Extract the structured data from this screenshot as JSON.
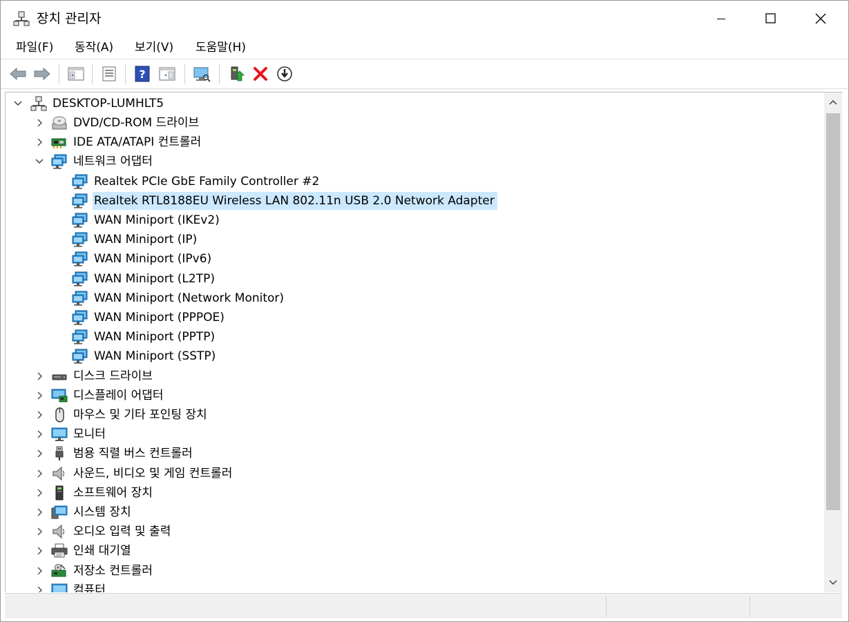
{
  "window": {
    "title": "장치 관리자"
  },
  "menu": {
    "items": [
      "파일(F)",
      "동작(A)",
      "보기(V)",
      "도움말(H)"
    ]
  },
  "toolbar": {
    "buttons": [
      "back-icon",
      "forward-icon",
      "show-hide-console-tree-icon",
      "properties-icon",
      "help-icon",
      "action-pane-icon",
      "scan-hardware-icon",
      "update-driver-icon",
      "uninstall-device-icon",
      "disable-device-icon"
    ]
  },
  "colors": {
    "selection": "#cce8ff",
    "network_icon": "#2c8fd6",
    "uninstall_x": "#e8151f"
  },
  "tree": {
    "root": "DESKTOP-LUMHLT5",
    "rows": [
      {
        "label": "DVD/CD-ROM 드라이브",
        "level": 1,
        "expanded": false,
        "icon": "dvd-drive-icon"
      },
      {
        "label": "IDE ATA/ATAPI 컨트롤러",
        "level": 1,
        "expanded": false,
        "icon": "ide-controller-icon"
      },
      {
        "label": "네트워크 어댑터",
        "level": 1,
        "expanded": true,
        "icon": "network-adapter-icon"
      },
      {
        "label": "Realtek PCIe GbE Family Controller #2",
        "level": 2,
        "icon": "network-adapter-icon"
      },
      {
        "label": "Realtek RTL8188EU Wireless LAN 802.11n USB 2.0 Network Adapter",
        "level": 2,
        "icon": "network-adapter-icon",
        "selected": true
      },
      {
        "label": "WAN Miniport (IKEv2)",
        "level": 2,
        "icon": "network-adapter-icon"
      },
      {
        "label": "WAN Miniport (IP)",
        "level": 2,
        "icon": "network-adapter-icon"
      },
      {
        "label": "WAN Miniport (IPv6)",
        "level": 2,
        "icon": "network-adapter-icon"
      },
      {
        "label": "WAN Miniport (L2TP)",
        "level": 2,
        "icon": "network-adapter-icon"
      },
      {
        "label": "WAN Miniport (Network Monitor)",
        "level": 2,
        "icon": "network-adapter-icon"
      },
      {
        "label": "WAN Miniport (PPPOE)",
        "level": 2,
        "icon": "network-adapter-icon"
      },
      {
        "label": "WAN Miniport (PPTP)",
        "level": 2,
        "icon": "network-adapter-icon"
      },
      {
        "label": "WAN Miniport (SSTP)",
        "level": 2,
        "icon": "network-adapter-icon"
      },
      {
        "label": "디스크 드라이브",
        "level": 1,
        "expanded": false,
        "icon": "disk-drive-icon"
      },
      {
        "label": "디스플레이 어댑터",
        "level": 1,
        "expanded": false,
        "icon": "display-adapter-icon"
      },
      {
        "label": "마우스 및 기타 포인팅 장치",
        "level": 1,
        "expanded": false,
        "icon": "mouse-icon"
      },
      {
        "label": "모니터",
        "level": 1,
        "expanded": false,
        "icon": "monitor-icon"
      },
      {
        "label": "범용 직렬 버스 컨트롤러",
        "level": 1,
        "expanded": false,
        "icon": "usb-icon"
      },
      {
        "label": "사운드, 비디오 및 게임 컨트롤러",
        "level": 1,
        "expanded": false,
        "icon": "speaker-icon"
      },
      {
        "label": "소프트웨어 장치",
        "level": 1,
        "expanded": false,
        "icon": "software-device-icon"
      },
      {
        "label": "시스템 장치",
        "level": 1,
        "expanded": false,
        "icon": "system-device-icon"
      },
      {
        "label": "오디오 입력 및 출력",
        "level": 1,
        "expanded": false,
        "icon": "speaker-icon"
      },
      {
        "label": "인쇄 대기열",
        "level": 1,
        "expanded": false,
        "icon": "printer-icon"
      },
      {
        "label": "저장소 컨트롤러",
        "level": 1,
        "expanded": false,
        "icon": "storage-controller-icon"
      },
      {
        "label": "컴퓨터",
        "level": 1,
        "expanded": false,
        "icon": "computer-icon"
      }
    ]
  }
}
